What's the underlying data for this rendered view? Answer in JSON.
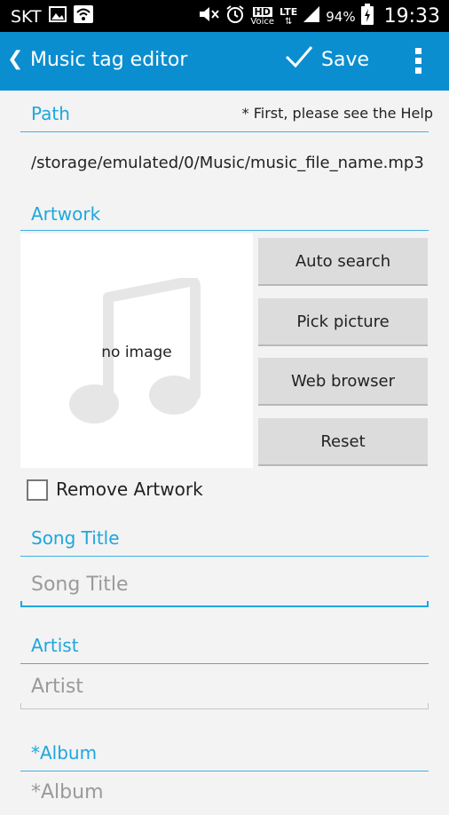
{
  "status_bar": {
    "carrier": "SKT",
    "hd_voice_label": "HD",
    "voice_label": "Voice",
    "network": "LTE",
    "battery": "94%",
    "time": "19:33"
  },
  "app_bar": {
    "back_glyph": "❮",
    "title": "Music tag editor",
    "save_label": "Save"
  },
  "path_section": {
    "label": "Path",
    "help_note": "* First, please see the Help",
    "path_value": "/storage/emulated/0/Music/music_file_name.mp3"
  },
  "artwork_section": {
    "label": "Artwork",
    "placeholder_text": "no image",
    "buttons": [
      {
        "label": "Auto search"
      },
      {
        "label": "Pick picture"
      },
      {
        "label": "Web browser"
      },
      {
        "label": "Reset"
      }
    ],
    "remove_checkbox_label": "Remove Artwork",
    "remove_checked": false
  },
  "fields": {
    "song_title": {
      "label": "Song Title",
      "placeholder": "Song Title"
    },
    "artist": {
      "label": "Artist",
      "placeholder": "Artist"
    },
    "album": {
      "label": "*Album",
      "placeholder": "*Album"
    }
  },
  "colors": {
    "accent": "#1ea6df",
    "app_bar": "#0a8ed0",
    "status_bar": "#000000",
    "background": "#f3f3f3"
  }
}
